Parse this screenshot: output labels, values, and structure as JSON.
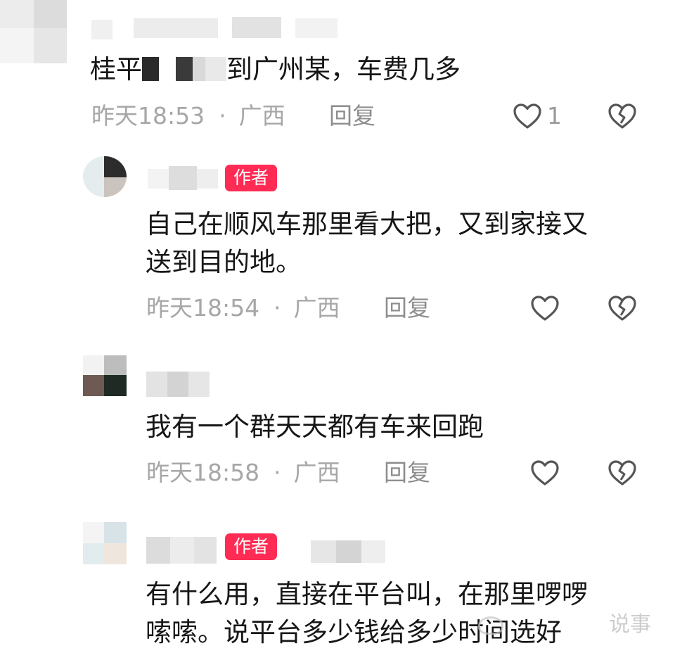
{
  "comments": [
    {
      "text_lines": [
        "桂平",
        "到广州某，车费几多"
      ],
      "time": "昨天18:53",
      "region": "广西",
      "reply_label": "回复",
      "like_count": "1"
    },
    {
      "badge": "作者",
      "text_lines": [
        "自己在顺风车那里看大把，又到家接又",
        "送到目的地。"
      ],
      "time": "昨天18:54",
      "region": "广西",
      "reply_label": "回复"
    },
    {
      "text_lines": [
        "我有一个群天天都有车来回跑"
      ],
      "time": "昨天18:58",
      "region": "广西",
      "reply_label": "回复"
    },
    {
      "badge": "作者",
      "text_lines": [
        "有什么用，直接在平台叫，在那里啰啰",
        "嗦嗦。说平台多少钱给多少时间选好"
      ]
    }
  ],
  "separator": "·",
  "watermark": "说事",
  "colors": {
    "badge": "#fe2c55",
    "meta": "#a7a7a7",
    "text": "#161616"
  },
  "icons": [
    "heart-outline-icon",
    "broken-heart-icon"
  ]
}
